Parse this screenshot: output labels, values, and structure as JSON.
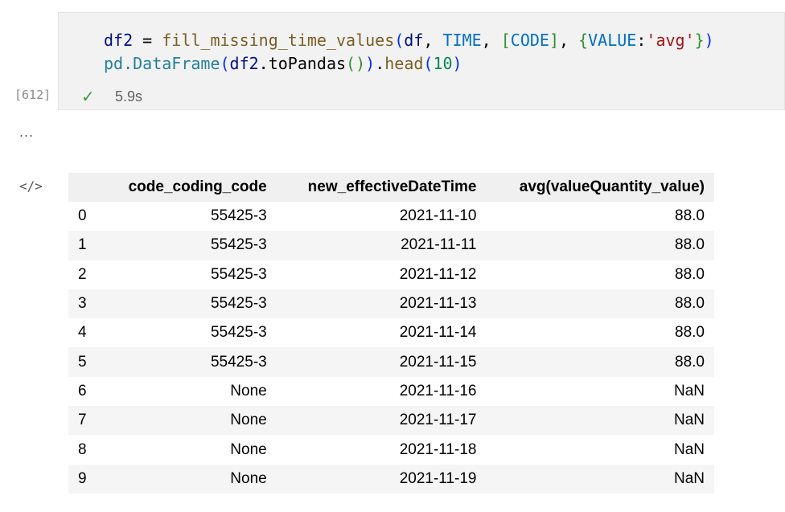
{
  "cell": {
    "execution_count": "[612]",
    "status_icon": "check-icon",
    "duration": "5.9s",
    "code_line1": {
      "var": "df2",
      "eq": " = ",
      "fn": "fill_missing_time_values",
      "p1": "(",
      "a1": "df",
      ", ": ", ",
      "a2": "TIME",
      "c2": ", ",
      "b1": "[",
      "a3": "CODE",
      "b2": "]",
      "c3": ", ",
      "d1": "{",
      "a4": "VALUE",
      ":": ":",
      "s": "'avg'",
      "d2": "}",
      "p2": ")"
    },
    "code_line2": {
      "pd": "pd.",
      "cls": "DataFrame",
      "p1": "(",
      "var": "df2",
      ".toPandas": ".toPandas",
      "p2": "(",
      "p3": ")",
      "p4": ")",
      ".": ".",
      "fn": "head",
      "p5": "(",
      "n": "10",
      "p6": ")"
    }
  },
  "output": {
    "more_icon": "ellipsis-icon",
    "code_icon": "code-icon",
    "ellipsis": "...",
    "code_glyph": "</>"
  },
  "table": {
    "columns": [
      "",
      "code_coding_code",
      "new_effectiveDateTime",
      "avg(valueQuantity_value)"
    ],
    "rows": [
      [
        "0",
        "55425-3",
        "2021-11-10",
        "88.0"
      ],
      [
        "1",
        "55425-3",
        "2021-11-11",
        "88.0"
      ],
      [
        "2",
        "55425-3",
        "2021-11-12",
        "88.0"
      ],
      [
        "3",
        "55425-3",
        "2021-11-13",
        "88.0"
      ],
      [
        "4",
        "55425-3",
        "2021-11-14",
        "88.0"
      ],
      [
        "5",
        "55425-3",
        "2021-11-15",
        "88.0"
      ],
      [
        "6",
        "None",
        "2021-11-16",
        "NaN"
      ],
      [
        "7",
        "None",
        "2021-11-17",
        "NaN"
      ],
      [
        "8",
        "None",
        "2021-11-18",
        "NaN"
      ],
      [
        "9",
        "None",
        "2021-11-19",
        "NaN"
      ]
    ]
  }
}
